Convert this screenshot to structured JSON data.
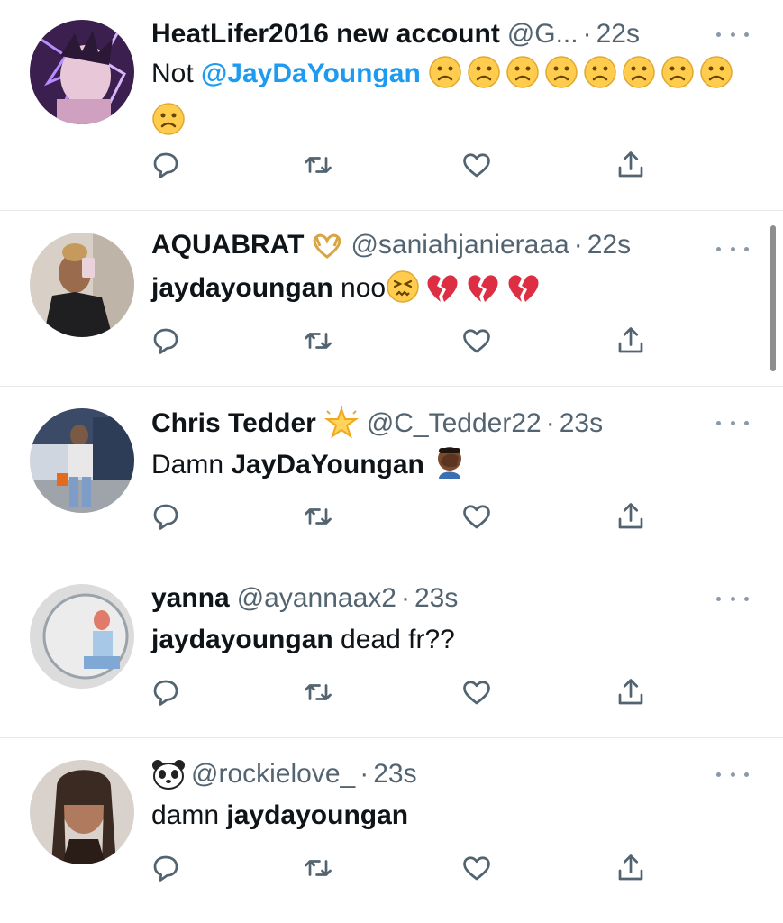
{
  "tweets": [
    {
      "name": "HeatLifer2016 new account",
      "handle": "@G...",
      "time": "22s",
      "prefix": "Not ",
      "mention": "@JayDaYoungan",
      "rest": "",
      "emoji": [
        "frowning-face",
        "frowning-face",
        "frowning-face",
        "frowning-face",
        "frowning-face",
        "frowning-face",
        "frowning-face",
        "frowning-face",
        "frowning-face"
      ]
    },
    {
      "name": "AQUABRAT",
      "handle": "@saniahjanieraaa",
      "time": "22s",
      "bold": "jaydayoungan",
      "rest": " noo",
      "emoji": [
        "persevering-face",
        "broken-heart",
        "broken-heart",
        "broken-heart"
      ]
    },
    {
      "name": "Chris Tedder",
      "handle": "@C_Tedder22",
      "time": "23s",
      "prefix": "Damn ",
      "bold": "JayDaYoungan",
      "emoji": [
        "face-palm"
      ]
    },
    {
      "name": "yanna",
      "handle": "@ayannaax2",
      "time": "23s",
      "bold": "jaydayoungan",
      "rest": " dead fr??",
      "emoji": []
    },
    {
      "name": "",
      "handle": "@rockielove_",
      "time": "23s",
      "prefix": "damn ",
      "bold": "jaydayoungan",
      "emoji": []
    }
  ],
  "separator": "·",
  "colors": {
    "text": "#0f1419",
    "secondary": "#536471",
    "link": "#1d9bf0",
    "divider": "#e6e9ec"
  },
  "icons": [
    "reply-icon",
    "retweet-icon",
    "like-icon",
    "share-icon",
    "more-icon"
  ]
}
